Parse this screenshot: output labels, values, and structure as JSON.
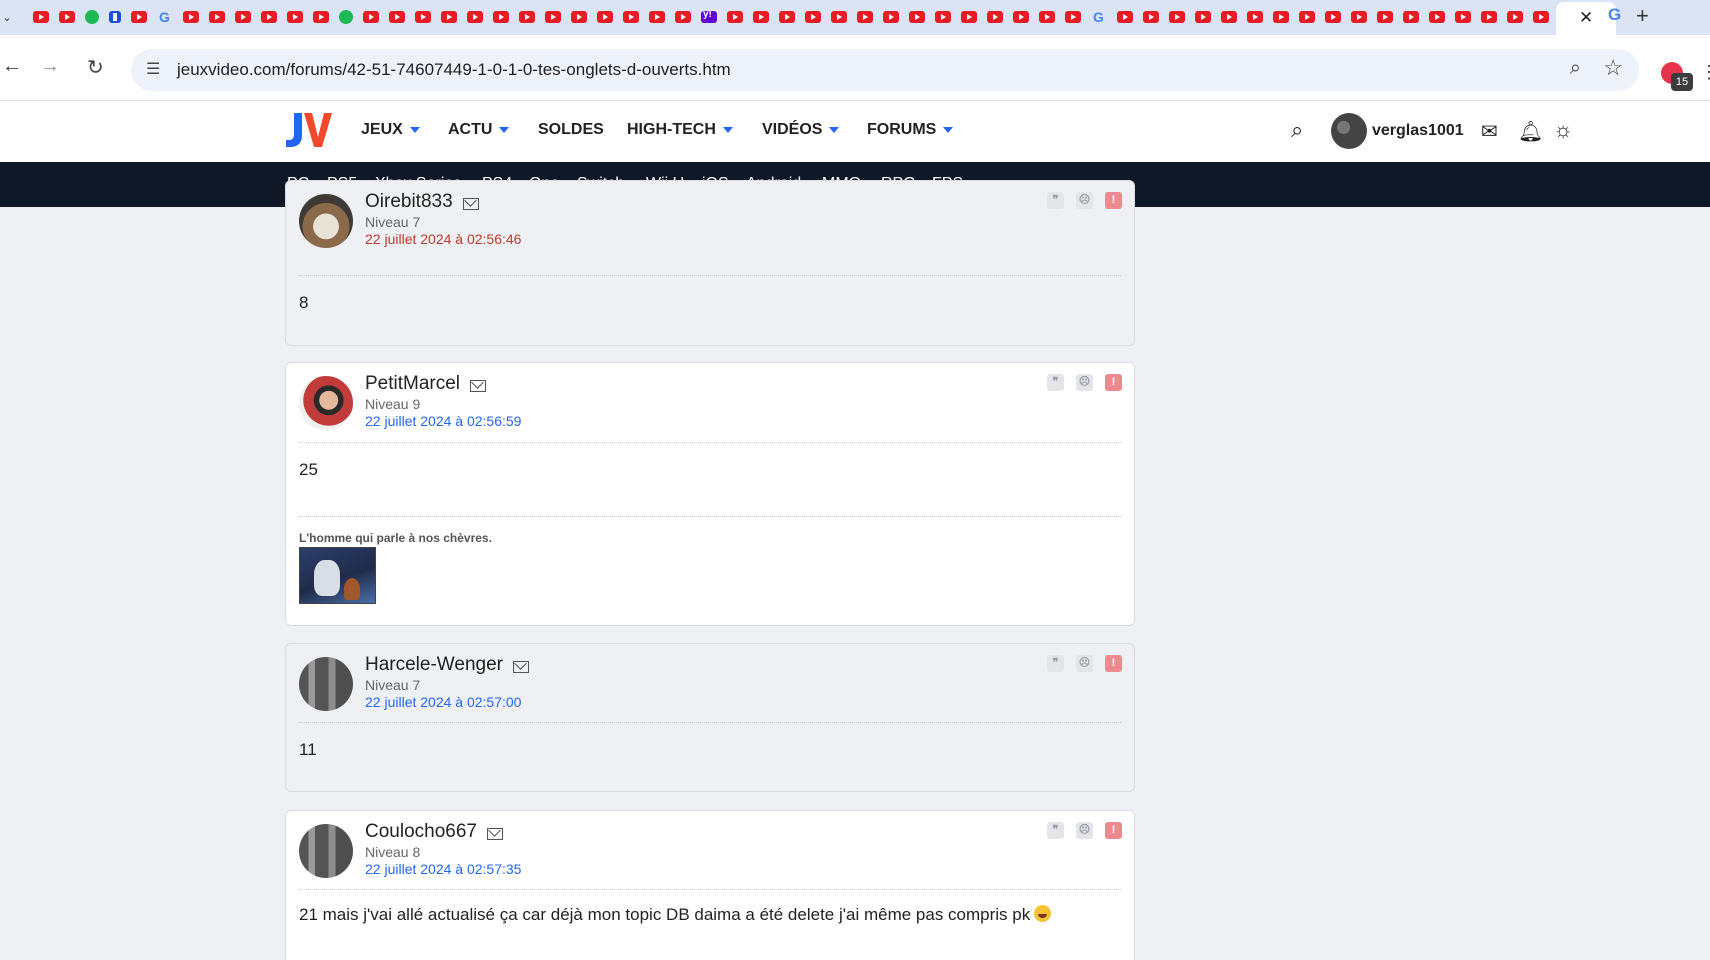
{
  "browser": {
    "url": "jeuxvideo.com/forums/42-51-74607449-1-0-1-0-tes-onglets-d-ouverts.htm",
    "extension_badge": "15",
    "tabs_pattern": [
      "yt",
      "yt",
      "spotify",
      "dl",
      "yt",
      "google",
      "yt",
      "yt",
      "yt",
      "yt",
      "yt",
      "yt",
      "dot",
      "yt",
      "yt",
      "yt",
      "yt",
      "yt",
      "yt",
      "yt",
      "yt",
      "yt",
      "yt",
      "yt",
      "yt",
      "yt",
      "yahoo",
      "yt",
      "yt",
      "yt",
      "yt",
      "yt",
      "yt",
      "yt",
      "yt",
      "yt",
      "yt",
      "yt",
      "yt",
      "yt",
      "yt",
      "google",
      "yt",
      "yt",
      "yt",
      "yt",
      "yt",
      "yt",
      "yt",
      "yt",
      "yt",
      "yt",
      "yt",
      "yt",
      "yt",
      "yt",
      "yt",
      "yt",
      "yt",
      "yt",
      "yt",
      "dl",
      "yt",
      "yt",
      "yt",
      "yt",
      "yt",
      "yt",
      "yt",
      "google",
      "dl",
      "yt",
      "yt",
      "yt",
      "yt",
      "yt",
      "yt",
      "yt",
      "yt",
      "yt",
      "yt",
      "yt",
      "yt",
      "yt",
      "yt",
      "yt",
      "yt"
    ]
  },
  "site": {
    "nav": [
      "JEUX",
      "ACTU",
      "SOLDES",
      "HIGH-TECH",
      "VIDÉOS",
      "FORUMS"
    ],
    "username": "verglas1001",
    "platforms": [
      "PC",
      "PS5",
      "Xbox Series",
      "PS4",
      "One",
      "Switch",
      "Wii U",
      "iOS",
      "Android",
      "MMO",
      "RPG",
      "FPS"
    ],
    "accent": "#2366f2",
    "dark_bar": "#101828"
  },
  "posts": [
    {
      "author": "Oirebit833",
      "level": "Niveau 7",
      "date": "22 juillet 2024 à 02:56:46",
      "message": "8"
    },
    {
      "author": "PetitMarcel",
      "level": "Niveau 9",
      "date": "22 juillet 2024 à 02:56:59",
      "message": "25",
      "signature_label": "L'homme qui parle à nos chèvres."
    },
    {
      "author": "Harcele-Wenger",
      "level": "Niveau 7",
      "date": "22 juillet 2024 à 02:57:00",
      "message": "11"
    },
    {
      "author": "Coulocho667",
      "level": "Niveau 8",
      "date": "22 juillet 2024 à 02:57:35",
      "message": "21 mais j'vai allé actualisé ça car déjà mon topic DB daima a été delete j'ai même pas compris pk"
    }
  ]
}
